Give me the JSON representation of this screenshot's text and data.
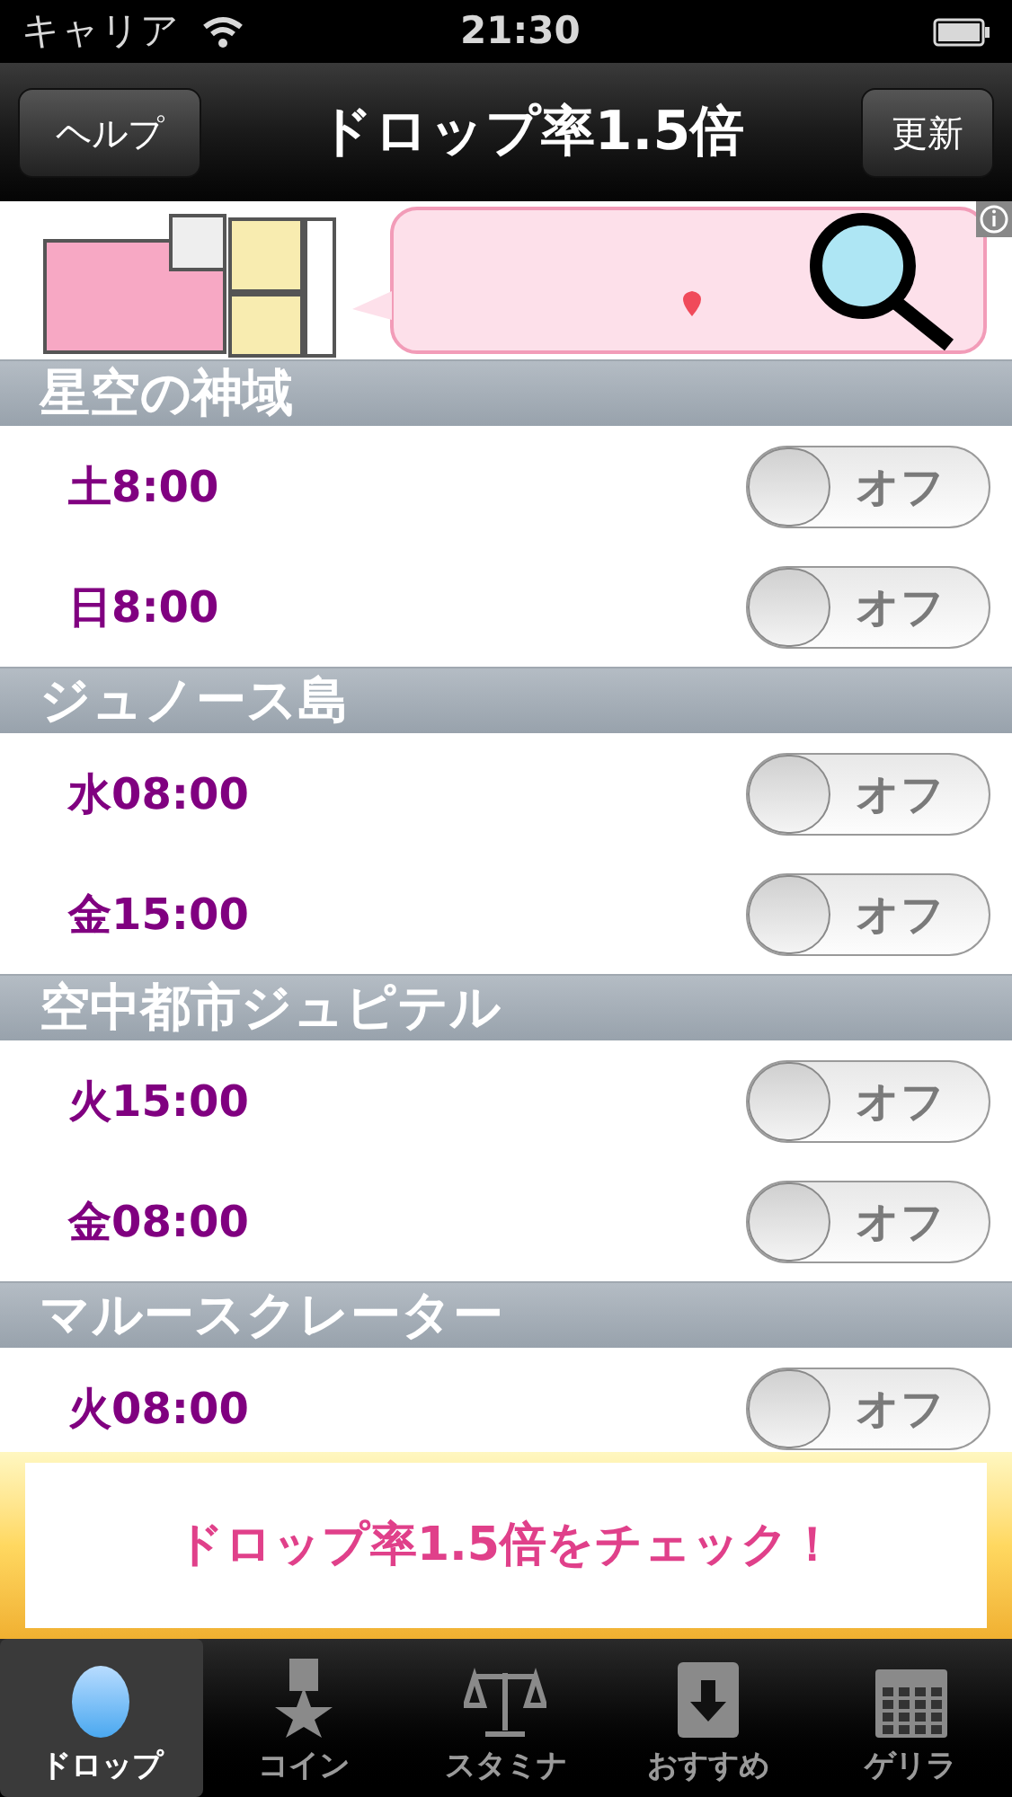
{
  "status_bar": {
    "carrier": "キャリア",
    "time": "21:30"
  },
  "nav": {
    "left_button": "ヘルプ",
    "title": "ドロップ率1.5倍",
    "right_button": "更新"
  },
  "sections": [
    {
      "title": "星空の神域",
      "rows": [
        {
          "time": "土8:00",
          "on": false,
          "switch_label": "オフ"
        },
        {
          "time": "日8:00",
          "on": false,
          "switch_label": "オフ"
        }
      ]
    },
    {
      "title": "ジュノース島",
      "rows": [
        {
          "time": "水08:00",
          "on": false,
          "switch_label": "オフ"
        },
        {
          "time": "金15:00",
          "on": false,
          "switch_label": "オフ"
        }
      ]
    },
    {
      "title": "空中都市ジュピテル",
      "rows": [
        {
          "time": "火15:00",
          "on": false,
          "switch_label": "オフ"
        },
        {
          "time": "金08:00",
          "on": false,
          "switch_label": "オフ"
        }
      ]
    },
    {
      "title": "マルースクレーター",
      "rows": [
        {
          "time": "火08:00",
          "on": false,
          "switch_label": "オフ"
        }
      ]
    }
  ],
  "banner": {
    "text": "ドロップ率1.5倍をチェック！"
  },
  "tabs": [
    {
      "label": "ドロップ",
      "kind": "egg",
      "selected": true
    },
    {
      "label": "コイン",
      "kind": "medal",
      "selected": false
    },
    {
      "label": "スタミナ",
      "kind": "scale",
      "selected": false
    },
    {
      "label": "おすすめ",
      "kind": "download",
      "selected": false
    },
    {
      "label": "ゲリラ",
      "kind": "calendar",
      "selected": false
    }
  ]
}
